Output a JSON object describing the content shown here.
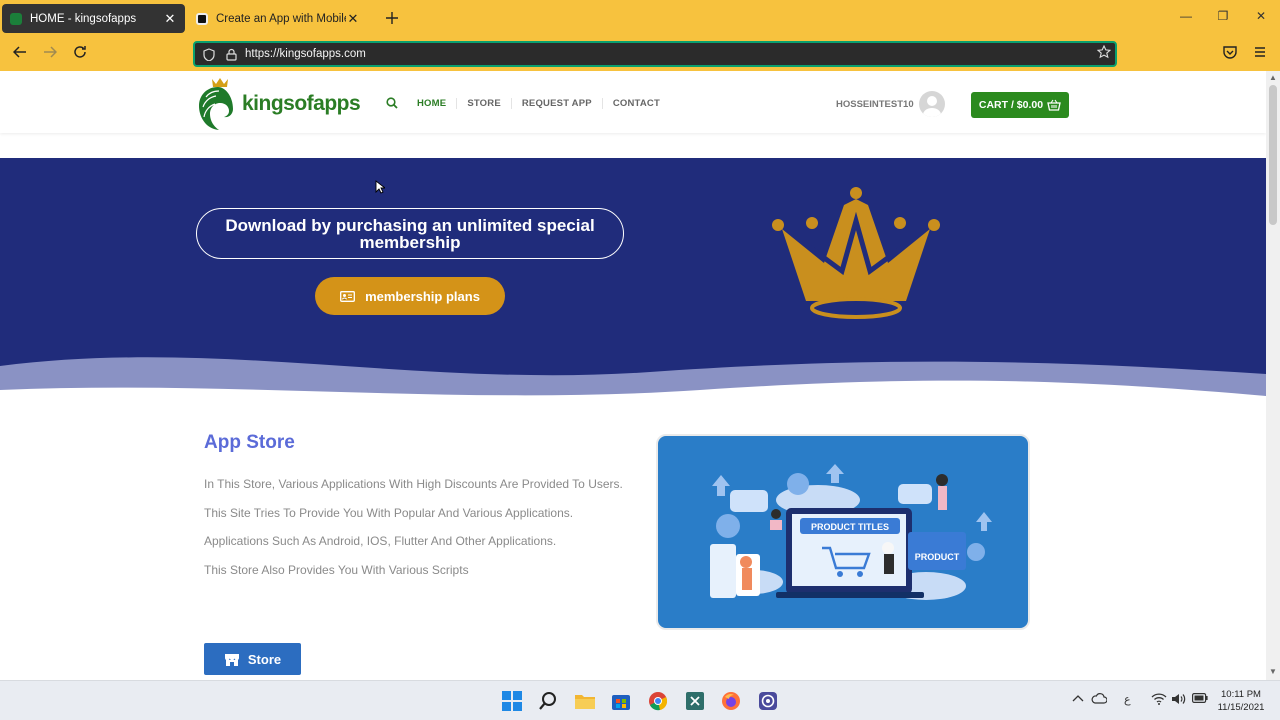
{
  "browser": {
    "tabs": [
      {
        "title": "HOME - kingsofapps",
        "active": true
      },
      {
        "title": "Create an App with Mobile App",
        "active": false
      }
    ],
    "new_tab_icon": "plus-icon",
    "url": "https://kingsofapps.com",
    "window_controls": {
      "minimize": "—",
      "restore": "❐",
      "close": "✕"
    },
    "accent_color": "#f7c23e"
  },
  "site": {
    "logo_text": "kingsofapps",
    "menu": [
      "HOME",
      "STORE",
      "REQUEST APP",
      "CONTACT"
    ],
    "username": "HOSSEINTEST10",
    "cart": "CART / $0.00",
    "brand_green": "#2b8a1e"
  },
  "hero": {
    "headline": "Download by purchasing an unlimited special membership",
    "button_label": "membership plans",
    "background": "#202c7b",
    "button_color": "#d49318"
  },
  "app_store": {
    "title": "App Store",
    "paragraphs": [
      "In This Store, Various Applications With High Discounts Are Provided To Users. This Site Tries To Provide You With Popular And Various Applications.",
      "Applications Such As Android, IOS, Flutter And Other Applications.",
      "This Store Also Provides You With Various Scripts"
    ],
    "button_label": "Store",
    "illustration_labels": {
      "product_titles": "PRODUCT TITLES",
      "product": "PRODUCT"
    }
  },
  "taskbar": {
    "icons": [
      "windows-start-icon",
      "search-icon",
      "file-explorer-icon",
      "store-icon",
      "chrome-icon",
      "app-icon",
      "firefox-icon",
      "obs-icon"
    ],
    "ime_label": "ع",
    "time": "10:11 PM",
    "date": "11/15/2021"
  }
}
